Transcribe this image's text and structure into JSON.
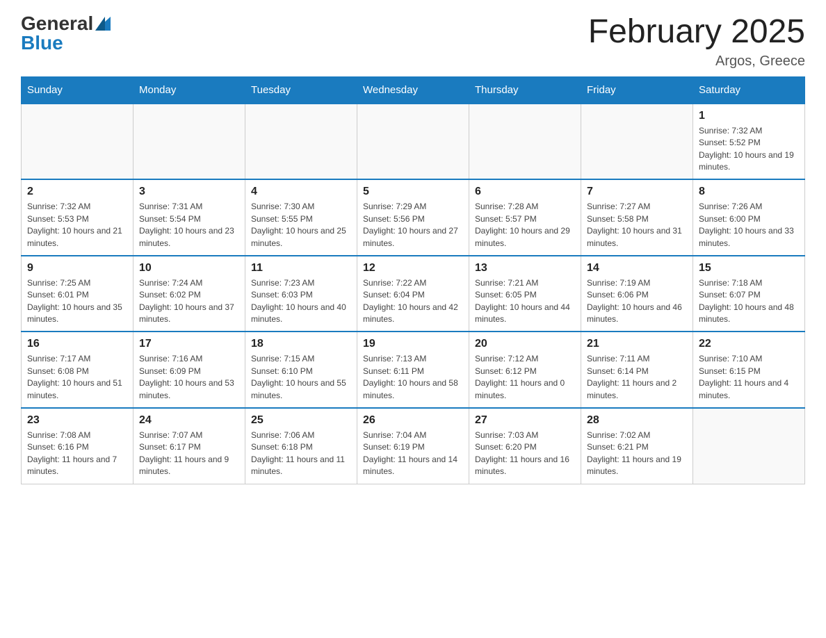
{
  "header": {
    "logo_general": "General",
    "logo_blue": "Blue",
    "month_title": "February 2025",
    "location": "Argos, Greece"
  },
  "weekdays": [
    "Sunday",
    "Monday",
    "Tuesday",
    "Wednesday",
    "Thursday",
    "Friday",
    "Saturday"
  ],
  "weeks": [
    [
      {
        "day": "",
        "info": ""
      },
      {
        "day": "",
        "info": ""
      },
      {
        "day": "",
        "info": ""
      },
      {
        "day": "",
        "info": ""
      },
      {
        "day": "",
        "info": ""
      },
      {
        "day": "",
        "info": ""
      },
      {
        "day": "1",
        "info": "Sunrise: 7:32 AM\nSunset: 5:52 PM\nDaylight: 10 hours and 19 minutes."
      }
    ],
    [
      {
        "day": "2",
        "info": "Sunrise: 7:32 AM\nSunset: 5:53 PM\nDaylight: 10 hours and 21 minutes."
      },
      {
        "day": "3",
        "info": "Sunrise: 7:31 AM\nSunset: 5:54 PM\nDaylight: 10 hours and 23 minutes."
      },
      {
        "day": "4",
        "info": "Sunrise: 7:30 AM\nSunset: 5:55 PM\nDaylight: 10 hours and 25 minutes."
      },
      {
        "day": "5",
        "info": "Sunrise: 7:29 AM\nSunset: 5:56 PM\nDaylight: 10 hours and 27 minutes."
      },
      {
        "day": "6",
        "info": "Sunrise: 7:28 AM\nSunset: 5:57 PM\nDaylight: 10 hours and 29 minutes."
      },
      {
        "day": "7",
        "info": "Sunrise: 7:27 AM\nSunset: 5:58 PM\nDaylight: 10 hours and 31 minutes."
      },
      {
        "day": "8",
        "info": "Sunrise: 7:26 AM\nSunset: 6:00 PM\nDaylight: 10 hours and 33 minutes."
      }
    ],
    [
      {
        "day": "9",
        "info": "Sunrise: 7:25 AM\nSunset: 6:01 PM\nDaylight: 10 hours and 35 minutes."
      },
      {
        "day": "10",
        "info": "Sunrise: 7:24 AM\nSunset: 6:02 PM\nDaylight: 10 hours and 37 minutes."
      },
      {
        "day": "11",
        "info": "Sunrise: 7:23 AM\nSunset: 6:03 PM\nDaylight: 10 hours and 40 minutes."
      },
      {
        "day": "12",
        "info": "Sunrise: 7:22 AM\nSunset: 6:04 PM\nDaylight: 10 hours and 42 minutes."
      },
      {
        "day": "13",
        "info": "Sunrise: 7:21 AM\nSunset: 6:05 PM\nDaylight: 10 hours and 44 minutes."
      },
      {
        "day": "14",
        "info": "Sunrise: 7:19 AM\nSunset: 6:06 PM\nDaylight: 10 hours and 46 minutes."
      },
      {
        "day": "15",
        "info": "Sunrise: 7:18 AM\nSunset: 6:07 PM\nDaylight: 10 hours and 48 minutes."
      }
    ],
    [
      {
        "day": "16",
        "info": "Sunrise: 7:17 AM\nSunset: 6:08 PM\nDaylight: 10 hours and 51 minutes."
      },
      {
        "day": "17",
        "info": "Sunrise: 7:16 AM\nSunset: 6:09 PM\nDaylight: 10 hours and 53 minutes."
      },
      {
        "day": "18",
        "info": "Sunrise: 7:15 AM\nSunset: 6:10 PM\nDaylight: 10 hours and 55 minutes."
      },
      {
        "day": "19",
        "info": "Sunrise: 7:13 AM\nSunset: 6:11 PM\nDaylight: 10 hours and 58 minutes."
      },
      {
        "day": "20",
        "info": "Sunrise: 7:12 AM\nSunset: 6:12 PM\nDaylight: 11 hours and 0 minutes."
      },
      {
        "day": "21",
        "info": "Sunrise: 7:11 AM\nSunset: 6:14 PM\nDaylight: 11 hours and 2 minutes."
      },
      {
        "day": "22",
        "info": "Sunrise: 7:10 AM\nSunset: 6:15 PM\nDaylight: 11 hours and 4 minutes."
      }
    ],
    [
      {
        "day": "23",
        "info": "Sunrise: 7:08 AM\nSunset: 6:16 PM\nDaylight: 11 hours and 7 minutes."
      },
      {
        "day": "24",
        "info": "Sunrise: 7:07 AM\nSunset: 6:17 PM\nDaylight: 11 hours and 9 minutes."
      },
      {
        "day": "25",
        "info": "Sunrise: 7:06 AM\nSunset: 6:18 PM\nDaylight: 11 hours and 11 minutes."
      },
      {
        "day": "26",
        "info": "Sunrise: 7:04 AM\nSunset: 6:19 PM\nDaylight: 11 hours and 14 minutes."
      },
      {
        "day": "27",
        "info": "Sunrise: 7:03 AM\nSunset: 6:20 PM\nDaylight: 11 hours and 16 minutes."
      },
      {
        "day": "28",
        "info": "Sunrise: 7:02 AM\nSunset: 6:21 PM\nDaylight: 11 hours and 19 minutes."
      },
      {
        "day": "",
        "info": ""
      }
    ]
  ]
}
